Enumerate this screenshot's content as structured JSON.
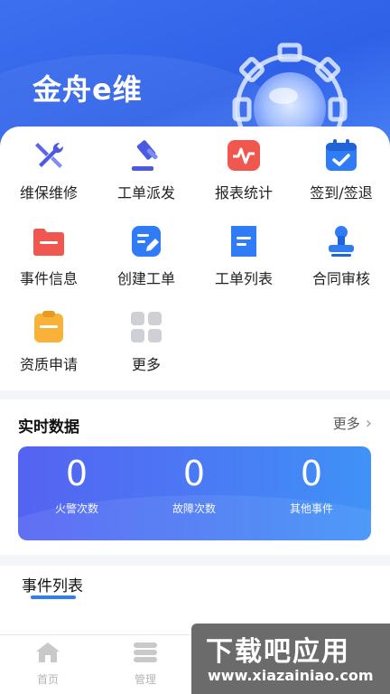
{
  "header": {
    "app_title": "金舟e维"
  },
  "grid": {
    "items": [
      {
        "label": "维保维修",
        "icon": "tools-icon"
      },
      {
        "label": "工单派发",
        "icon": "gavel-icon"
      },
      {
        "label": "报表统计",
        "icon": "pulse-chart-icon"
      },
      {
        "label": "签到/签退",
        "icon": "calendar-check-icon"
      },
      {
        "label": "事件信息",
        "icon": "folder-icon"
      },
      {
        "label": "创建工单",
        "icon": "edit-doc-icon"
      },
      {
        "label": "工单列表",
        "icon": "list-doc-icon"
      },
      {
        "label": "合同审核",
        "icon": "stamp-icon"
      },
      {
        "label": "资质申请",
        "icon": "clipboard-icon"
      },
      {
        "label": "更多",
        "icon": "more-grid-icon"
      }
    ]
  },
  "realtime": {
    "title": "实时数据",
    "more_label": "更多",
    "stats": [
      {
        "value": "0",
        "caption": "火警次数"
      },
      {
        "value": "0",
        "caption": "故障次数"
      },
      {
        "value": "0",
        "caption": "其他事件"
      }
    ]
  },
  "events": {
    "tab_label": "事件列表"
  },
  "tabbar": {
    "home_label": "首页",
    "manage_label": "管理"
  },
  "watermark": {
    "title": "下载吧应用",
    "url": "www.xiazainiao.com"
  },
  "colors": {
    "primary": "#2f61e8",
    "accent_blue": "#2f7cf6",
    "red": "#f0574f",
    "orange": "#f8b23a"
  }
}
